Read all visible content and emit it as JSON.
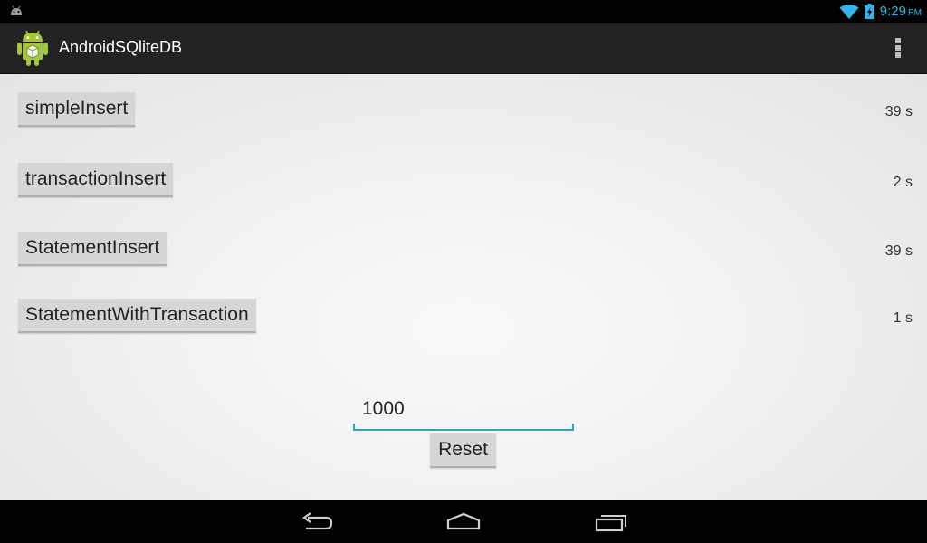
{
  "status_bar": {
    "time": "9:29",
    "ampm": "PM",
    "icons": [
      "android-notification-icon",
      "wifi-icon",
      "battery-charging-icon"
    ],
    "clock_color": "#33b5e5"
  },
  "action_bar": {
    "title": "AndroidSQliteDB",
    "app_icon": "android-app-icon",
    "menu_icon": "overflow-menu-icon"
  },
  "main": {
    "rows": [
      {
        "button_label": "simpleInsert",
        "time": "39 s"
      },
      {
        "button_label": "transactionInsert",
        "time": "2 s"
      },
      {
        "button_label": "StatementInsert",
        "time": "39 s"
      },
      {
        "button_label": "StatementWithTransaction",
        "time": "1 s"
      }
    ],
    "count_input": {
      "value": "1000"
    },
    "reset_label": "Reset",
    "accent_color": "#33a3c4"
  },
  "nav_bar": {
    "icons": [
      "back-icon",
      "home-icon",
      "recent-apps-icon"
    ]
  }
}
